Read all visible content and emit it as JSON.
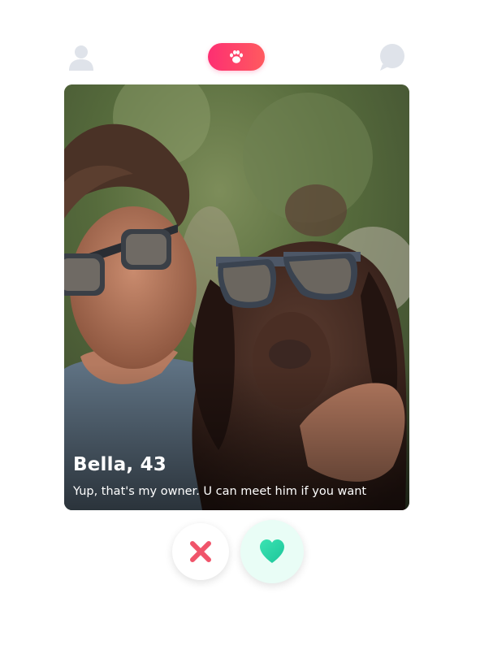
{
  "header": {
    "left_icon": "profile-icon",
    "center_icon": "paw-icon",
    "right_icon": "chat-icon",
    "accent_color": "#fd2f72"
  },
  "card": {
    "name_age": "Bella, 43",
    "bio": "Yup, that's my owner. U can meet him if you want",
    "photo": "man-and-dog-wearing-sunglasses-photo"
  },
  "actions": {
    "dislike_icon": "close-icon",
    "like_icon": "heart-icon",
    "dislike_color": "#f0546a",
    "like_color": "#2bd9a0"
  }
}
